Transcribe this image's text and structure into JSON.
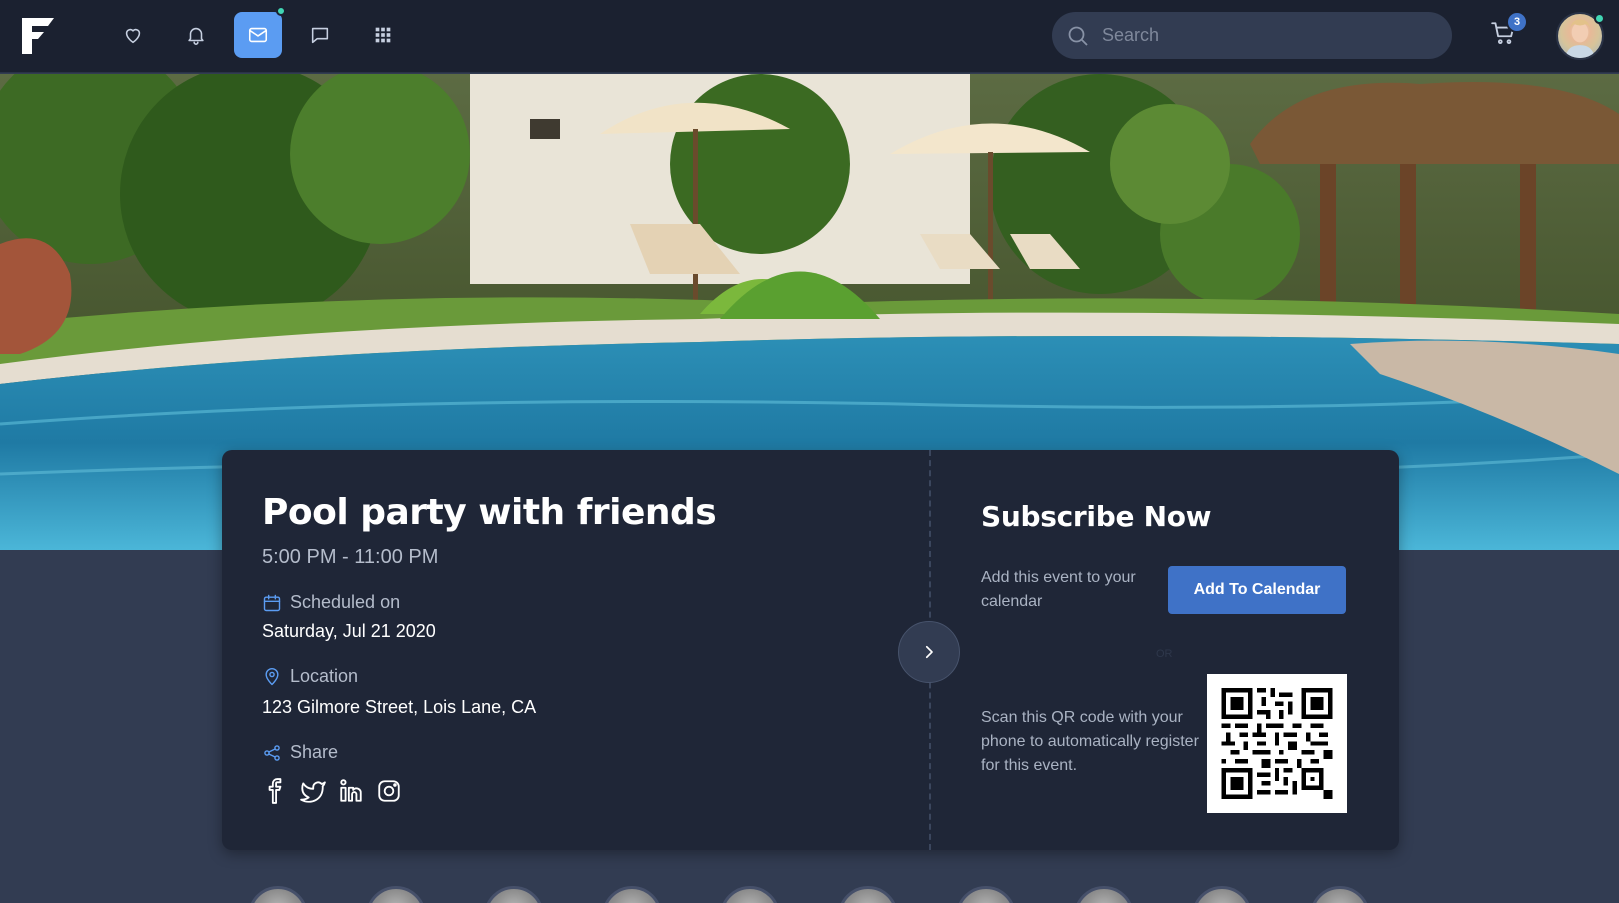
{
  "topbar": {
    "logo": "F",
    "nav": [
      {
        "icon": "heart-icon",
        "active": false
      },
      {
        "icon": "bell-icon",
        "active": false
      },
      {
        "icon": "mail-icon",
        "active": true,
        "notification": true
      },
      {
        "icon": "chat-icon",
        "active": false
      },
      {
        "icon": "apps-grid-icon",
        "active": false
      }
    ],
    "search_placeholder": "Search",
    "cart_count": "3"
  },
  "event": {
    "title": "Pool party with friends",
    "time": "5:00 PM - 11:00 PM",
    "scheduled_label": "Scheduled on",
    "scheduled_value": "Saturday, Jul 21 2020",
    "location_label": "Location",
    "location_value": "123 Gilmore Street, Lois Lane, CA",
    "share_label": "Share",
    "socials": [
      "facebook-icon",
      "twitter-icon",
      "linkedin-icon",
      "instagram-icon"
    ]
  },
  "subscribe": {
    "title": "Subscribe Now",
    "add_text": "Add this event to your calendar",
    "button_label": "Add To Calendar",
    "or_text": "OR",
    "qr_text": "Scan this QR code with your phone to automatically register for this event."
  },
  "colors": {
    "background": "#323c52",
    "topbar": "#1b2130",
    "card": "#1f2637",
    "accent": "#5b9cf2",
    "button": "#3f72c7",
    "online": "#41d6b4"
  },
  "attendees_count": 10
}
